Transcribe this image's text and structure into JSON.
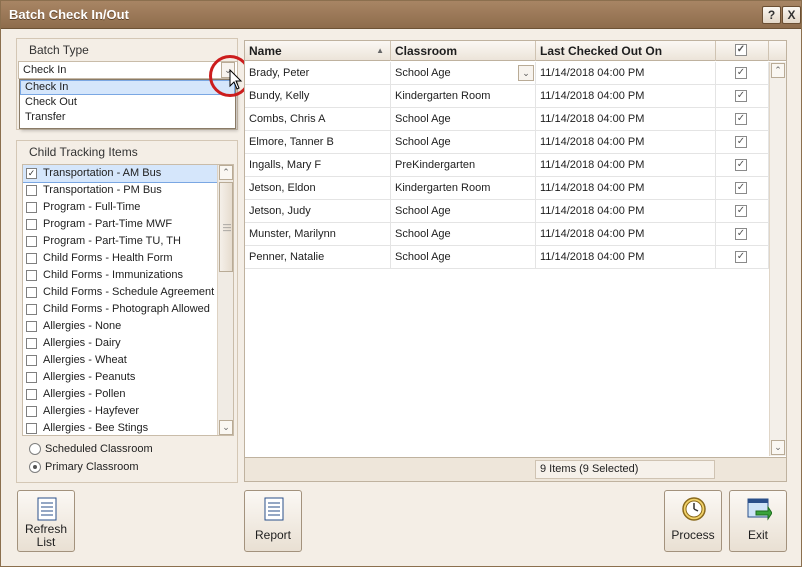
{
  "window": {
    "title": "Batch Check In/Out",
    "help_label": "?",
    "close_label": "X"
  },
  "batch_type": {
    "heading": "Batch Type",
    "selected": "Check In",
    "options": [
      "Check In",
      "Check Out",
      "Transfer"
    ]
  },
  "tracking": {
    "heading": "Child Tracking Items",
    "items": [
      {
        "label": "Transportation - AM Bus",
        "checked": true
      },
      {
        "label": "Transportation - PM Bus",
        "checked": false
      },
      {
        "label": "Program - Full-Time",
        "checked": false
      },
      {
        "label": "Program - Part-Time MWF",
        "checked": false
      },
      {
        "label": "Program - Part-Time TU, TH",
        "checked": false
      },
      {
        "label": "Child Forms - Health Form",
        "checked": false
      },
      {
        "label": "Child Forms - Immunizations",
        "checked": false
      },
      {
        "label": "Child Forms - Schedule Agreement",
        "checked": false
      },
      {
        "label": "Child Forms - Photograph Allowed",
        "checked": false
      },
      {
        "label": "Allergies - None",
        "checked": false
      },
      {
        "label": "Allergies - Dairy",
        "checked": false
      },
      {
        "label": "Allergies - Wheat",
        "checked": false
      },
      {
        "label": "Allergies - Peanuts",
        "checked": false
      },
      {
        "label": "Allergies - Pollen",
        "checked": false
      },
      {
        "label": "Allergies - Hayfever",
        "checked": false
      },
      {
        "label": "Allergies - Bee Stings",
        "checked": false
      }
    ],
    "radio_scheduled": "Scheduled Classroom",
    "radio_primary": "Primary Classroom",
    "selected_radio": "Primary Classroom"
  },
  "grid": {
    "columns": {
      "name": "Name",
      "classroom": "Classroom",
      "last_checked_out": "Last Checked Out On"
    },
    "rows": [
      {
        "name": "Brady, Peter",
        "classroom": "School Age",
        "last": "11/14/2018 04:00 PM",
        "checked": true
      },
      {
        "name": "Bundy, Kelly",
        "classroom": "Kindergarten Room",
        "last": "11/14/2018 04:00 PM",
        "checked": true
      },
      {
        "name": "Combs, Chris A",
        "classroom": "School Age",
        "last": "11/14/2018 04:00 PM",
        "checked": true
      },
      {
        "name": "Elmore, Tanner B",
        "classroom": "School Age",
        "last": "11/14/2018 04:00 PM",
        "checked": true
      },
      {
        "name": "Ingalls, Mary F",
        "classroom": "PreKindergarten",
        "last": "11/14/2018 04:00 PM",
        "checked": true
      },
      {
        "name": "Jetson, Eldon",
        "classroom": "Kindergarten Room",
        "last": "11/14/2018 04:00 PM",
        "checked": true
      },
      {
        "name": "Jetson, Judy",
        "classroom": "School Age",
        "last": "11/14/2018 04:00 PM",
        "checked": true
      },
      {
        "name": "Munster, Marilynn",
        "classroom": "School Age",
        "last": "11/14/2018 04:00 PM",
        "checked": true
      },
      {
        "name": "Penner, Natalie",
        "classroom": "School Age",
        "last": "11/14/2018 04:00 PM",
        "checked": true
      }
    ],
    "footer": "9 Items (9 Selected)"
  },
  "buttons": {
    "refresh_line1": "Refresh",
    "refresh_line2": "List",
    "report": "Report",
    "process": "Process",
    "exit": "Exit"
  },
  "colors": {
    "titlebar": "#9a7858",
    "accent_ring": "#cc1d1d",
    "selection": "#d5e6fb"
  }
}
